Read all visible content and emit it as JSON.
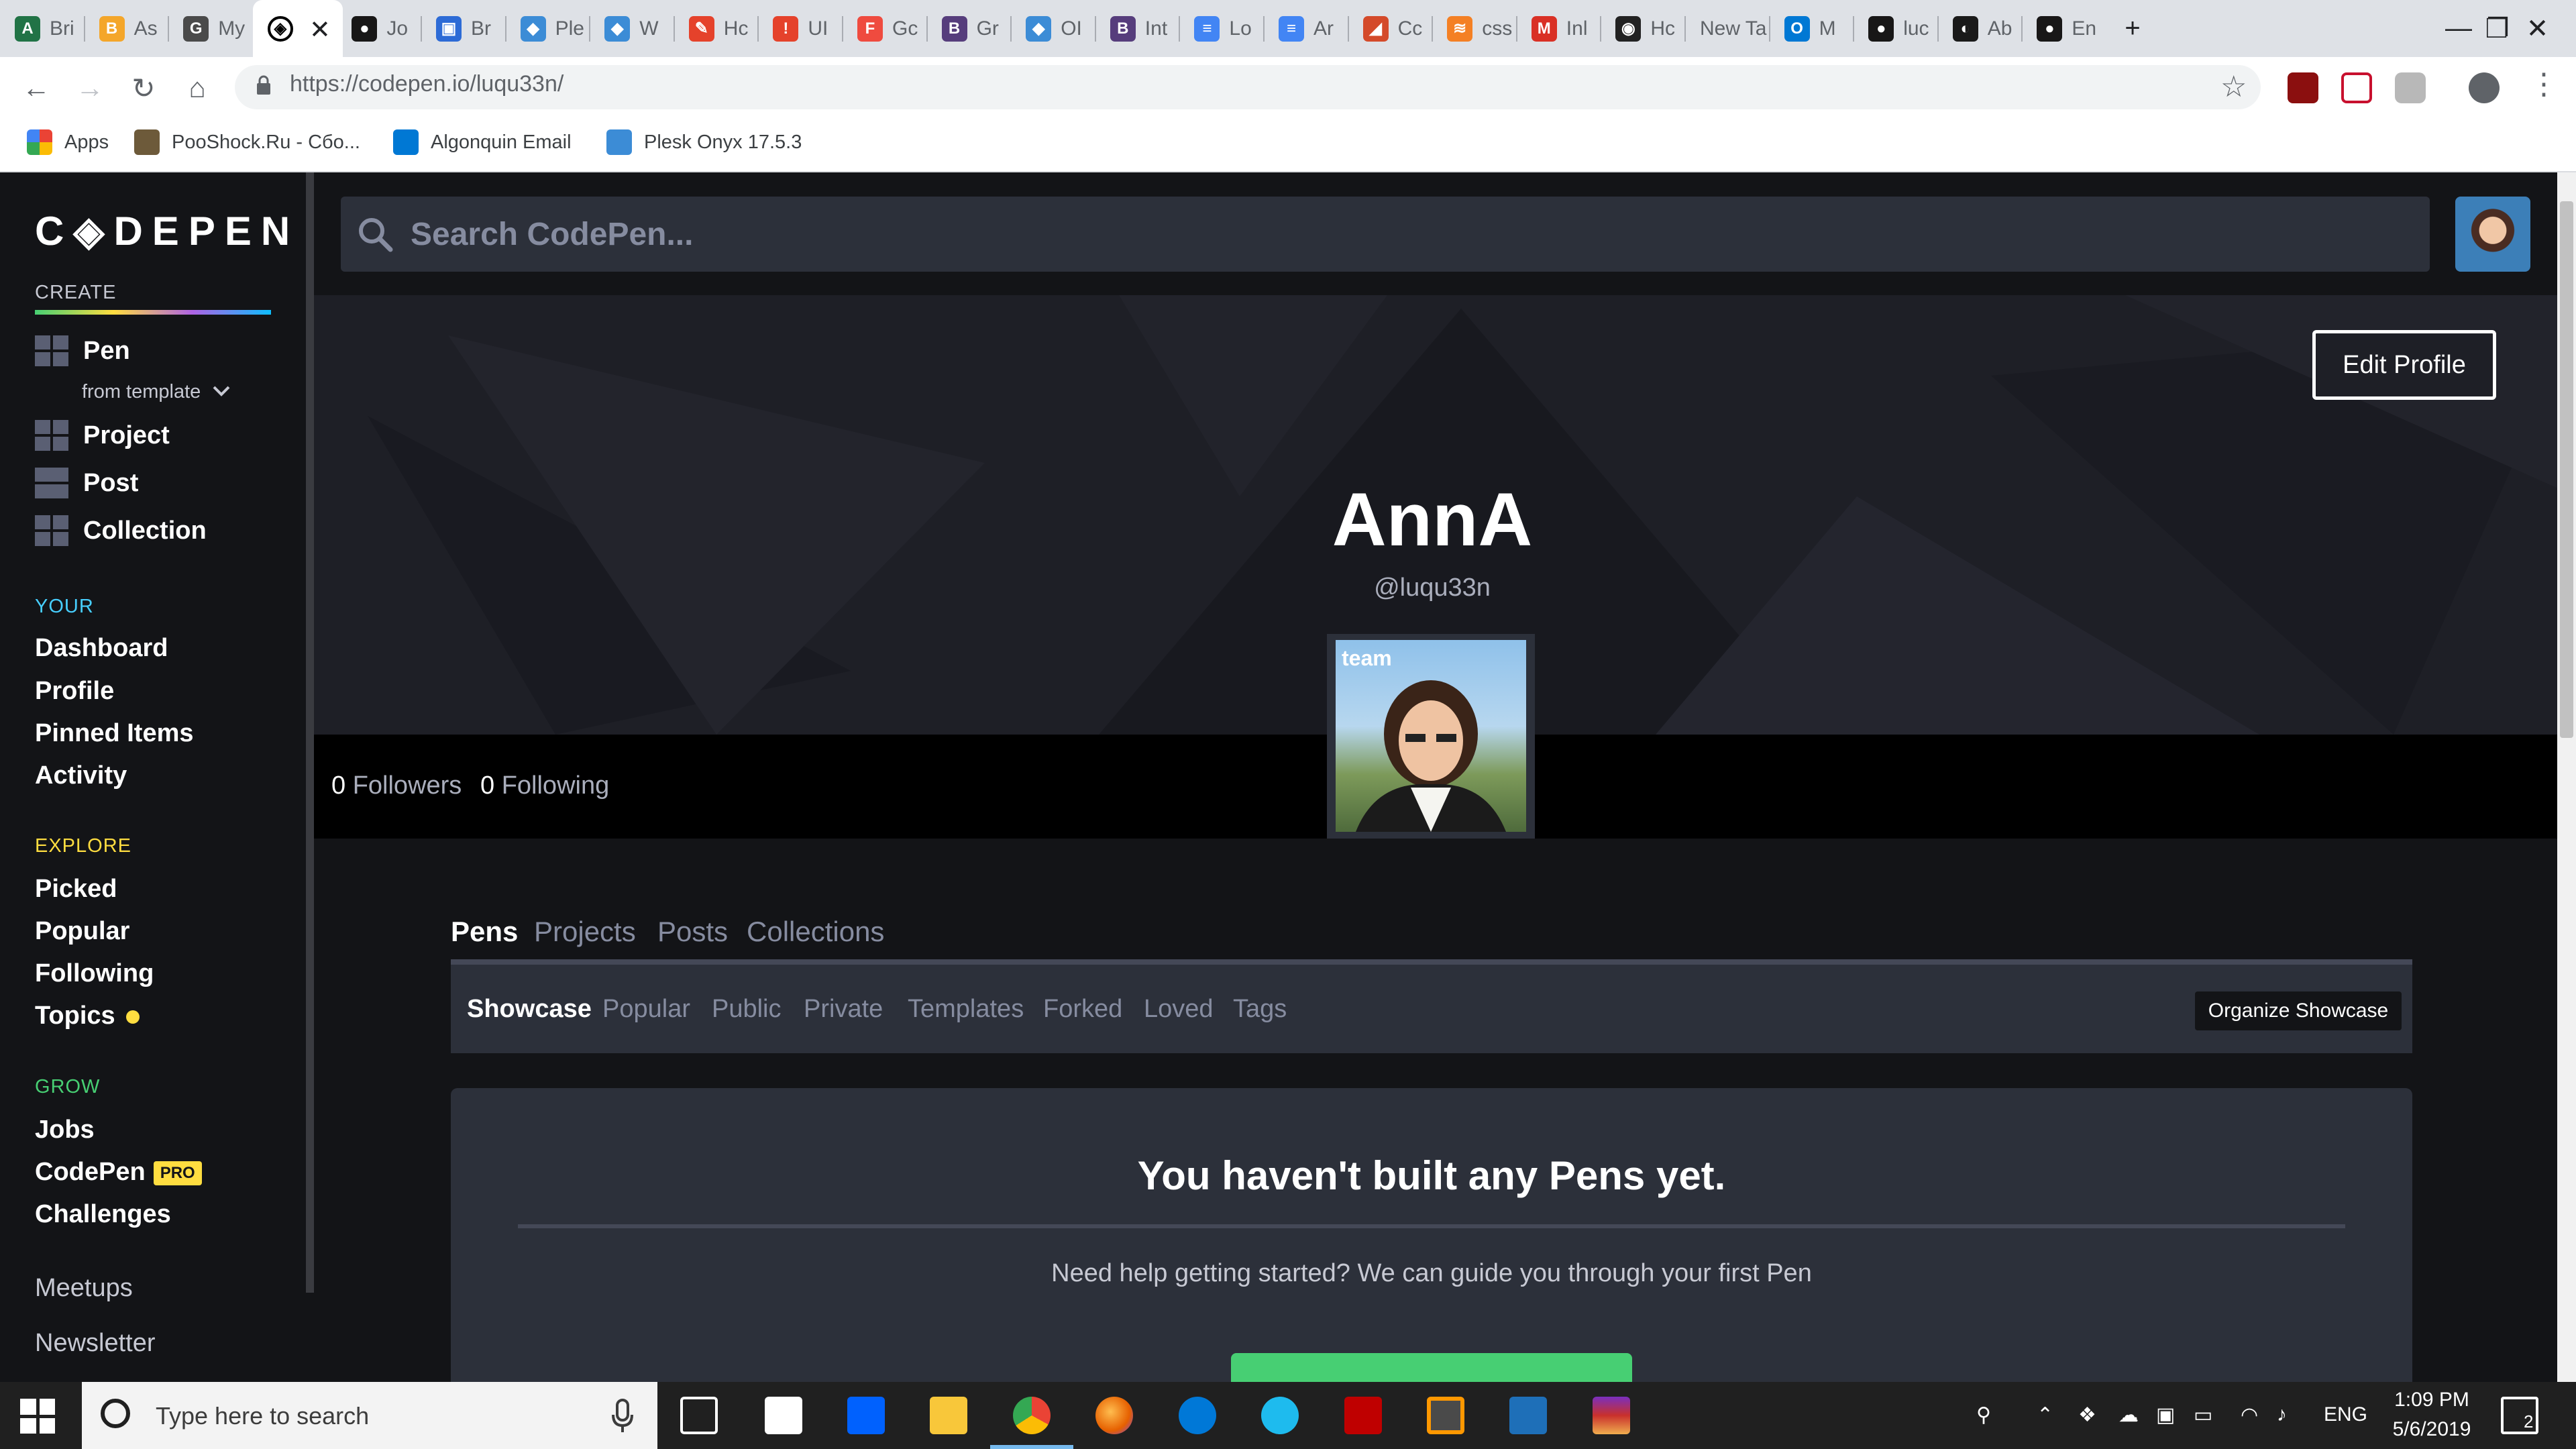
{
  "browser": {
    "tabs": [
      {
        "label": "Bri",
        "color": "#217346",
        "glyph": "A"
      },
      {
        "label": "As",
        "color": "#f4a62a",
        "glyph": "B"
      },
      {
        "label": "My",
        "color": "#4a4a4a",
        "glyph": "G"
      },
      {
        "label": "",
        "color": "#000000",
        "glyph": "◈",
        "active": true
      },
      {
        "label": "Jo",
        "color": "#181717",
        "glyph": "●"
      },
      {
        "label": "Br",
        "color": "#2d6bd6",
        "glyph": "▣"
      },
      {
        "label": "Ple",
        "color": "#3c8cd6",
        "glyph": "◆"
      },
      {
        "label": "W",
        "color": "#3c8cd6",
        "glyph": "◆"
      },
      {
        "label": "Hc",
        "color": "#e5422b",
        "glyph": "✎"
      },
      {
        "label": "UI",
        "color": "#e5422b",
        "glyph": "!"
      },
      {
        "label": "Gc",
        "color": "#ef4b3f",
        "glyph": "F"
      },
      {
        "label": "Gr",
        "color": "#563d7c",
        "glyph": "B"
      },
      {
        "label": "OI",
        "color": "#3c8cd6",
        "glyph": "◆"
      },
      {
        "label": "Int",
        "color": "#563d7c",
        "glyph": "B"
      },
      {
        "label": "Lo",
        "color": "#4285f4",
        "glyph": "≡"
      },
      {
        "label": "Ar",
        "color": "#4285f4",
        "glyph": "≡"
      },
      {
        "label": "Cc",
        "color": "#d44a2a",
        "glyph": "◢"
      },
      {
        "label": "css",
        "color": "#f48024",
        "glyph": "≋"
      },
      {
        "label": "Inl",
        "color": "#d93025",
        "glyph": "M"
      },
      {
        "label": "Hc",
        "color": "#222222",
        "glyph": "◉"
      },
      {
        "label": "New Ta",
        "color": "",
        "glyph": ""
      },
      {
        "label": "M",
        "color": "#0078d4",
        "glyph": "O"
      },
      {
        "label": "luc",
        "color": "#181717",
        "glyph": "●"
      },
      {
        "label": "Ab",
        "color": "#1a1a1a",
        "glyph": "◐"
      },
      {
        "label": "En",
        "color": "#181717",
        "glyph": "●"
      }
    ],
    "new_tab_glyph": "+",
    "window_controls": {
      "minimize": "—",
      "restore": "❐",
      "close": "✕"
    },
    "url": "https://codepen.io/luqu33n/",
    "nav": {
      "back": "←",
      "forward": "→",
      "reload": "↻",
      "home": "⌂"
    },
    "star": "☆",
    "bookmarks": [
      {
        "label": "Apps",
        "icon": "apps-grid-icon",
        "color": "#ea4335"
      },
      {
        "label": "PooShock.Ru - Сбо...",
        "icon": "bookmark-favicon",
        "color": "#6d5a3a"
      },
      {
        "label": "Algonquin Email",
        "icon": "outlook-icon",
        "color": "#0078d4"
      },
      {
        "label": "Plesk Onyx 17.5.3",
        "icon": "plesk-icon",
        "color": "#3c8cd6"
      }
    ]
  },
  "sidebar": {
    "logo": "C◈DEPEN",
    "create_heading": "CREATE",
    "create_items": [
      {
        "label": "Pen"
      },
      {
        "label": "Project"
      },
      {
        "label": "Post"
      },
      {
        "label": "Collection"
      }
    ],
    "from_template": "from template",
    "your_heading": "YOUR",
    "your_items": [
      "Dashboard",
      "Profile",
      "Pinned Items",
      "Activity"
    ],
    "explore_heading": "EXPLORE",
    "explore_items": [
      "Picked",
      "Popular",
      "Following",
      "Topics"
    ],
    "grow_heading": "GROW",
    "grow_items": [
      "Jobs",
      "CodePen",
      "Challenges"
    ],
    "pro_badge": "PRO",
    "misc_items": [
      "Meetups",
      "Newsletter"
    ],
    "colors": {
      "your": "#47cfff",
      "explore": "#ffdd40",
      "grow": "#47cf73",
      "create": "#c7c9d3"
    }
  },
  "main": {
    "search_placeholder": "Search CodePen...",
    "edit_profile": "Edit Profile",
    "profile_name": "AnnA",
    "profile_handle": "@luqu33n",
    "followers_count": "0",
    "followers_label": "Followers",
    "following_count": "0",
    "following_label": "Following",
    "avatar_badge": "team",
    "tabs": [
      "Pens",
      "Projects",
      "Posts",
      "Collections"
    ],
    "subtabs": [
      "Showcase",
      "Popular",
      "Public",
      "Private",
      "Templates",
      "Forked",
      "Loved",
      "Tags"
    ],
    "organize_showcase": "Organize Showcase",
    "empty_title": "You haven't built any Pens yet.",
    "empty_sub": "Need help getting started? We can guide you through your first Pen"
  },
  "taskbar": {
    "search_placeholder": "Type here to search",
    "language": "ENG",
    "time": "1:09 PM",
    "date": "5/6/2019",
    "notifications": "2"
  }
}
